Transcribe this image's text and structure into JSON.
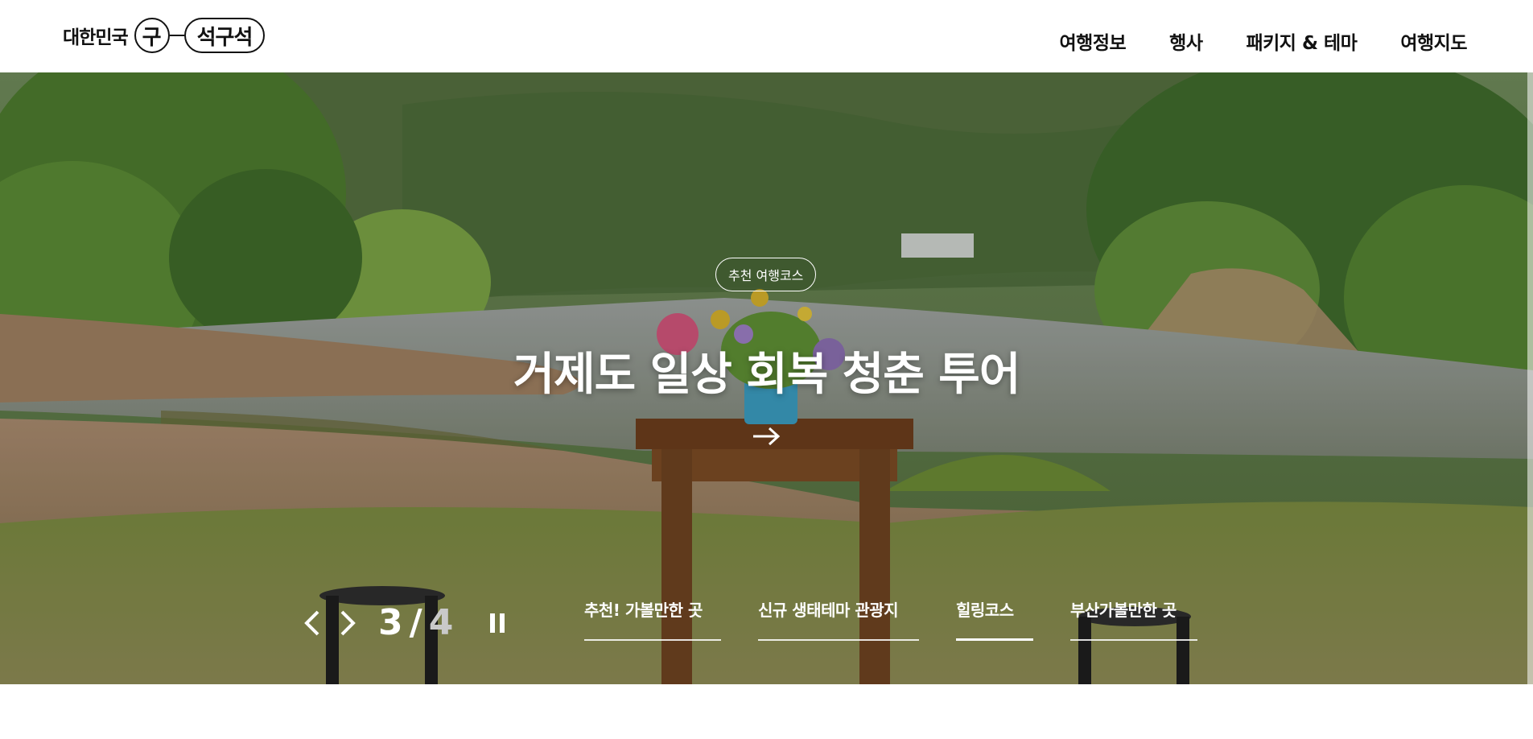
{
  "header": {
    "logo": {
      "prefix": "대한민국",
      "circle_char": "구",
      "pill_text": "석구석"
    },
    "nav": [
      "여행정보",
      "행사",
      "패키지 & 테마",
      "여행지도"
    ]
  },
  "hero": {
    "badge": "추천 여행코스",
    "title": "거제도 일상 회복 청춘 투어",
    "arrow_icon": "arrow-right-icon"
  },
  "slider": {
    "current": "3",
    "separator": "/",
    "total": "4",
    "prev_icon": "chevron-left-icon",
    "next_icon": "chevron-right-icon",
    "pause_icon": "pause-icon"
  },
  "tabs": [
    "추천! 가볼만한 곳",
    "신규 생태테마 관광지",
    "힐링코스",
    "부산가볼만한 곳"
  ],
  "colors": {
    "text": "#111111",
    "hero_text": "#ffffff",
    "counter_total": "#c9c9c9"
  }
}
